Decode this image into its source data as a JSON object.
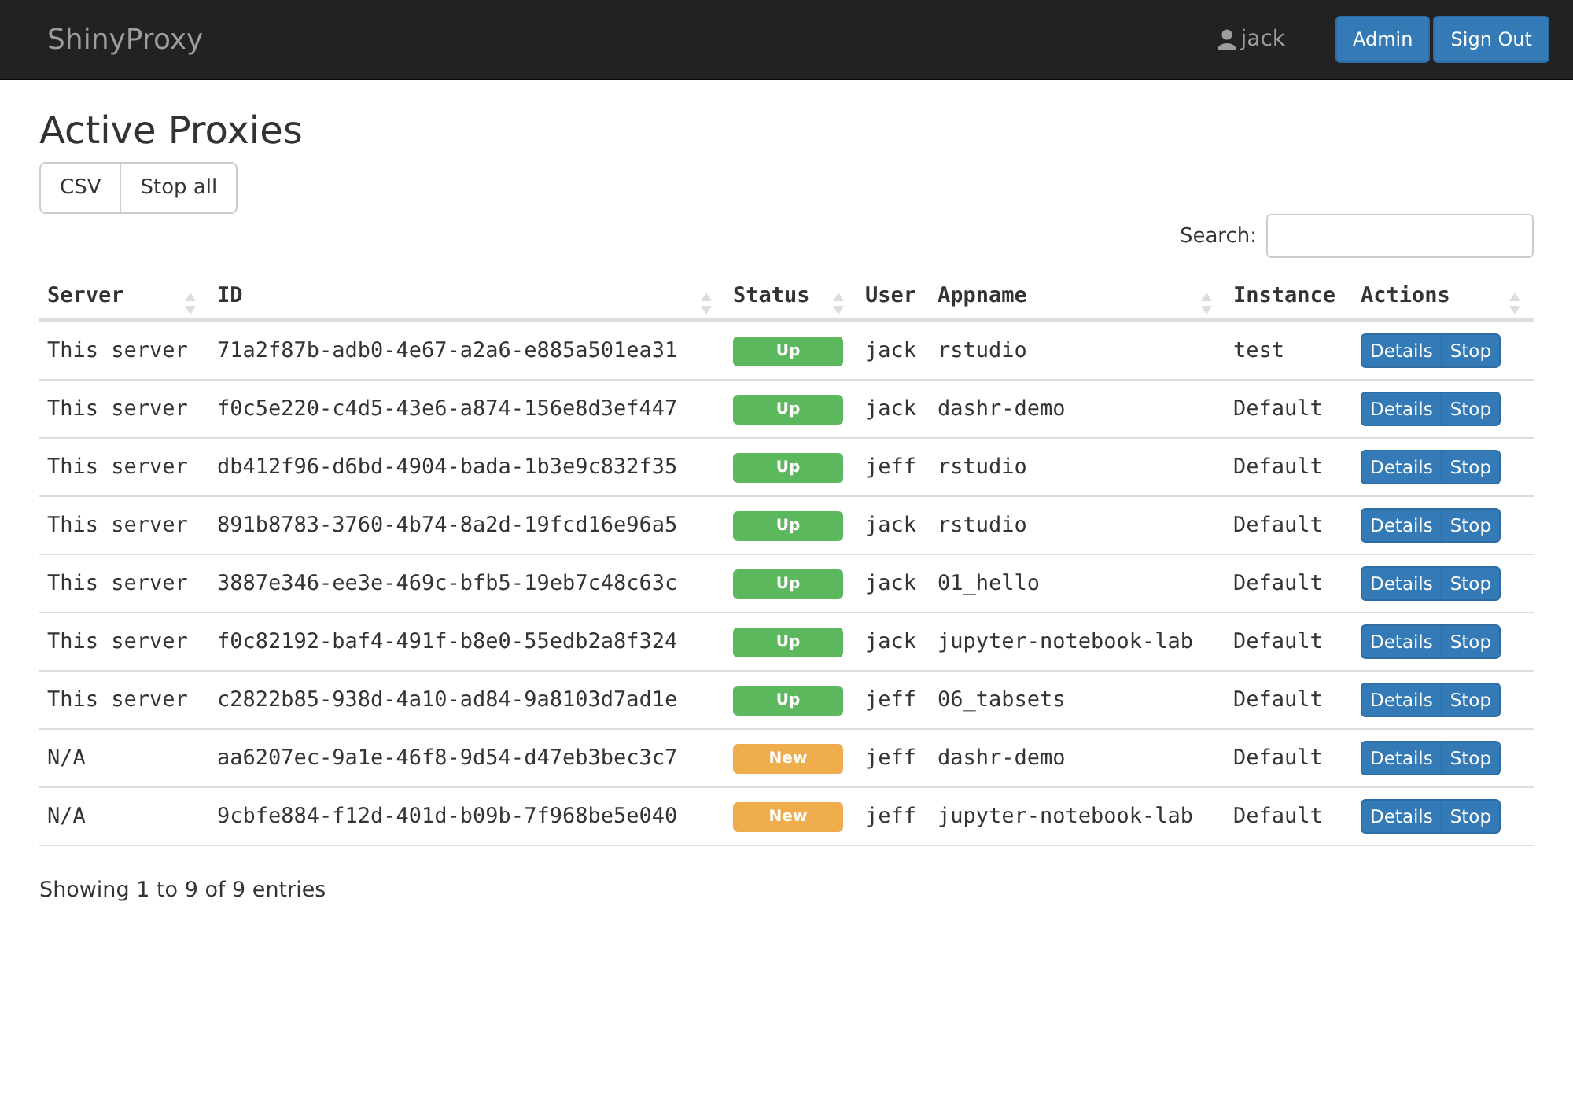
{
  "navbar": {
    "brand": "ShinyProxy",
    "user": "jack",
    "buttons": [
      "Admin",
      "Sign Out"
    ]
  },
  "page": {
    "title": "Active Proxies",
    "toolbar_buttons": [
      "CSV",
      "Stop all"
    ],
    "search": {
      "label": "Search:"
    }
  },
  "table": {
    "columns": [
      {
        "label": "Server",
        "sortable": true
      },
      {
        "label": "ID",
        "sortable": true
      },
      {
        "label": "Status",
        "sortable": true
      },
      {
        "label": "User",
        "sortable": false
      },
      {
        "label": "Appname",
        "sortable": true
      },
      {
        "label": "Instance",
        "sortable": false
      },
      {
        "label": "Actions",
        "sortable": true
      }
    ],
    "rows": [
      {
        "server": "This server",
        "id": "71a2f87b-adb0-4e67-a2a6-e885a501ea31",
        "status": {
          "kind": "up",
          "label": "Up"
        },
        "user": "jack",
        "appname": "rstudio",
        "instance": "test",
        "actions": [
          "Details",
          "Stop"
        ]
      },
      {
        "server": "This server",
        "id": "f0c5e220-c4d5-43e6-a874-156e8d3ef447",
        "status": {
          "kind": "up",
          "label": "Up"
        },
        "user": "jack",
        "appname": "dashr-demo",
        "instance": "Default",
        "actions": [
          "Details",
          "Stop"
        ]
      },
      {
        "server": "This server",
        "id": "db412f96-d6bd-4904-bada-1b3e9c832f35",
        "status": {
          "kind": "up",
          "label": "Up"
        },
        "user": "jeff",
        "appname": "rstudio",
        "instance": "Default",
        "actions": [
          "Details",
          "Stop"
        ]
      },
      {
        "server": "This server",
        "id": "891b8783-3760-4b74-8a2d-19fcd16e96a5",
        "status": {
          "kind": "up",
          "label": "Up"
        },
        "user": "jack",
        "appname": "rstudio",
        "instance": "Default",
        "actions": [
          "Details",
          "Stop"
        ]
      },
      {
        "server": "This server",
        "id": "3887e346-ee3e-469c-bfb5-19eb7c48c63c",
        "status": {
          "kind": "up",
          "label": "Up"
        },
        "user": "jack",
        "appname": "01_hello",
        "instance": "Default",
        "actions": [
          "Details",
          "Stop"
        ]
      },
      {
        "server": "This server",
        "id": "f0c82192-baf4-491f-b8e0-55edb2a8f324",
        "status": {
          "kind": "up",
          "label": "Up"
        },
        "user": "jack",
        "appname": "jupyter-notebook-lab",
        "instance": "Default",
        "actions": [
          "Details",
          "Stop"
        ]
      },
      {
        "server": "This server",
        "id": "c2822b85-938d-4a10-ad84-9a8103d7ad1e",
        "status": {
          "kind": "up",
          "label": "Up"
        },
        "user": "jeff",
        "appname": "06_tabsets",
        "instance": "Default",
        "actions": [
          "Details",
          "Stop"
        ]
      },
      {
        "server": "N/A",
        "id": "aa6207ec-9a1e-46f8-9d54-d47eb3bec3c7",
        "status": {
          "kind": "new",
          "label": "New"
        },
        "user": "jeff",
        "appname": "dashr-demo",
        "instance": "Default",
        "actions": [
          "Details",
          "Stop"
        ]
      },
      {
        "server": "N/A",
        "id": "9cbfe884-f12d-401d-b09b-7f968be5e040",
        "status": {
          "kind": "new",
          "label": "New"
        },
        "user": "jeff",
        "appname": "jupyter-notebook-lab",
        "instance": "Default",
        "actions": [
          "Details",
          "Stop"
        ]
      }
    ]
  },
  "footer": {
    "info": "Showing 1 to 9 of 9 entries"
  }
}
